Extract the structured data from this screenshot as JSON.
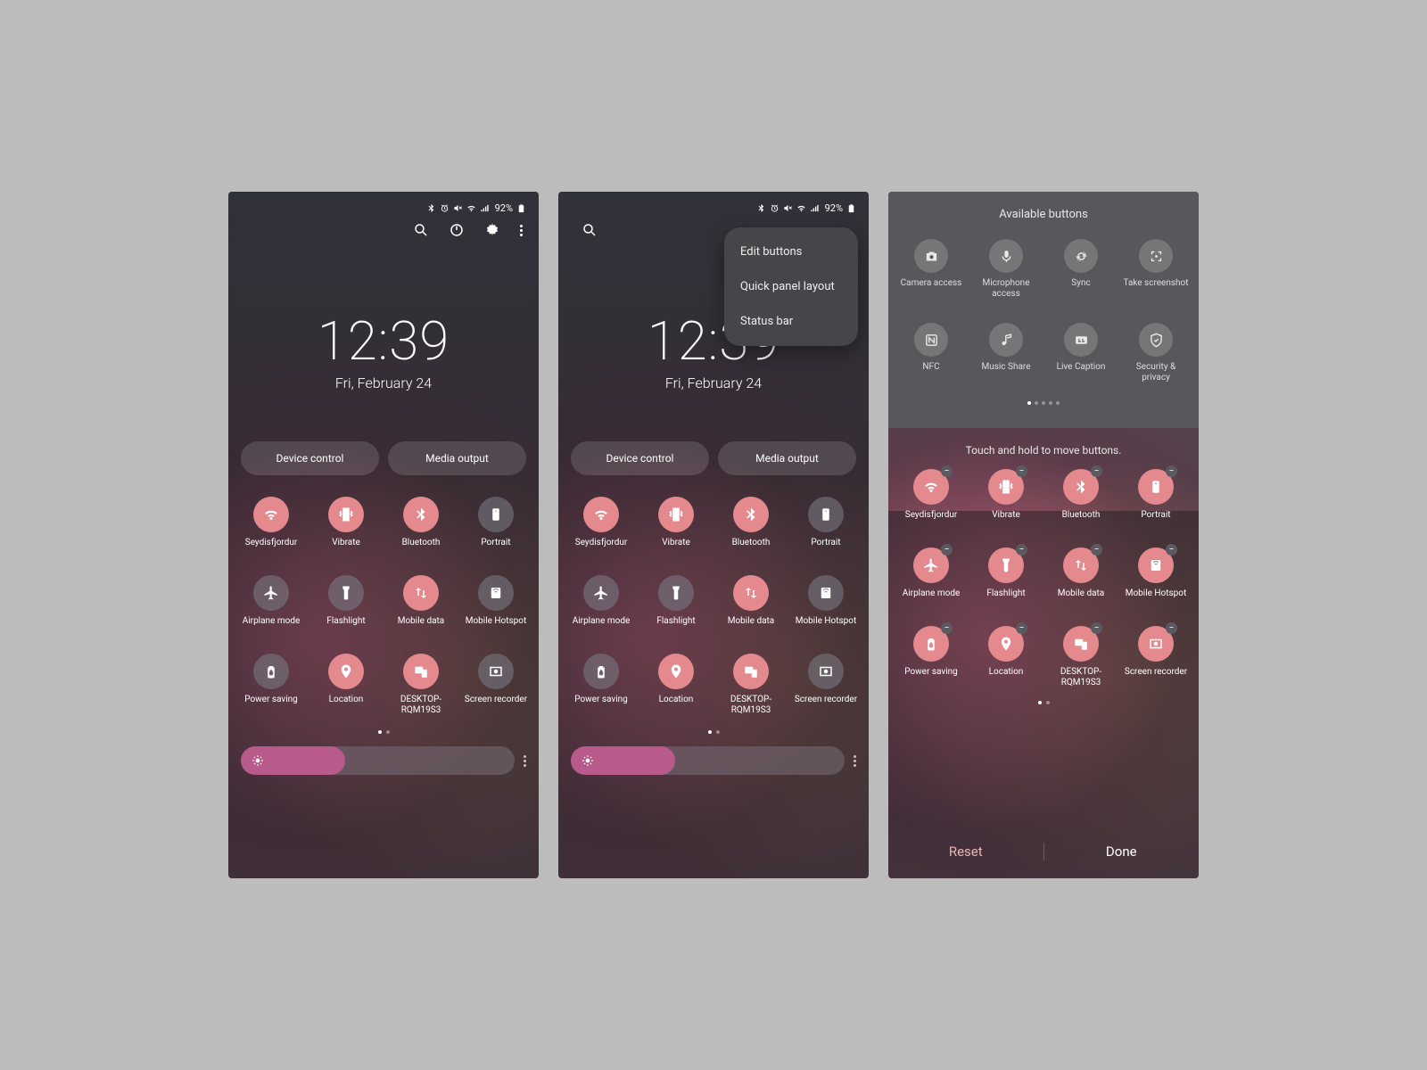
{
  "status": {
    "battery_pct": "92%"
  },
  "clock": {
    "time": "12:39",
    "date": "Fri, February 24"
  },
  "pills": {
    "device_control": "Device control",
    "media_output": "Media output"
  },
  "tiles": [
    {
      "label": "Seydisfjordur",
      "active": true,
      "icon": "wifi"
    },
    {
      "label": "Vibrate",
      "active": true,
      "icon": "vibrate"
    },
    {
      "label": "Bluetooth",
      "active": true,
      "icon": "bluetooth"
    },
    {
      "label": "Portrait",
      "active": false,
      "icon": "portrait"
    },
    {
      "label": "Airplane mode",
      "active": false,
      "icon": "airplane"
    },
    {
      "label": "Flashlight",
      "active": false,
      "icon": "flashlight"
    },
    {
      "label": "Mobile data",
      "active": true,
      "icon": "mobiledata"
    },
    {
      "label": "Mobile Hotspot",
      "active": false,
      "icon": "hotspot"
    },
    {
      "label": "Power saving",
      "active": false,
      "icon": "powersave"
    },
    {
      "label": "Location",
      "active": true,
      "icon": "location"
    },
    {
      "label": "DESKTOP-RQM19S3",
      "active": true,
      "icon": "link"
    },
    {
      "label": "Screen recorder",
      "active": false,
      "icon": "record"
    }
  ],
  "brightness_pct": 38,
  "popup": {
    "edit_buttons": "Edit buttons",
    "quick_panel_layout": "Quick panel layout",
    "status_bar": "Status bar"
  },
  "edit": {
    "available_title": "Available buttons",
    "buttons": [
      {
        "label": "Camera access",
        "icon": "camera"
      },
      {
        "label": "Microphone access",
        "icon": "mic"
      },
      {
        "label": "Sync",
        "icon": "sync"
      },
      {
        "label": "Take screenshot",
        "icon": "screenshot"
      },
      {
        "label": "NFC",
        "icon": "nfc"
      },
      {
        "label": "Music Share",
        "icon": "musicshare"
      },
      {
        "label": "Live Caption",
        "icon": "caption"
      },
      {
        "label": "Security & privacy",
        "icon": "shield"
      }
    ],
    "hint": "Touch and hold to move buttons.",
    "reset": "Reset",
    "done": "Done"
  },
  "edit_tiles_active": [
    true,
    true,
    true,
    true,
    true,
    true,
    true,
    true,
    true,
    true,
    true,
    true
  ]
}
